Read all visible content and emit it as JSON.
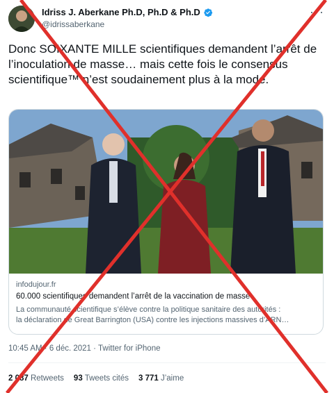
{
  "author": {
    "name": "Idriss J. Aberkane Ph.D, Ph.D & Ph.D",
    "handle": "@idrissaberkane"
  },
  "tweet": {
    "text": "Donc SOIXANTE MILLE scientifiques demandent l’arrêt de l’inoculation de masse… mais cette fois le consensus scientifique™ n’est soudainement plus à la mode."
  },
  "card": {
    "domain": "infodujour.fr",
    "title": "60.000 scientifiques demandent l’arrêt de la vaccination de masse",
    "desc_line1": "La communauté scientifique s’élève contre la politique sanitaire des autorités :",
    "desc_line2": "la déclaration de Great Barrington (USA) contre les injections massives d’ARN…"
  },
  "meta": {
    "time": "10:45 AM",
    "separator1": "·",
    "date": "6 déc. 2021",
    "separator2": "·",
    "source": "Twitter for iPhone"
  },
  "stats": {
    "retweets_count": "2 087",
    "retweets_label": "Retweets",
    "quotes_count": "93",
    "quotes_label": "Tweets cités",
    "likes_count": "3 771",
    "likes_label": "J’aime"
  },
  "colors": {
    "verified": "#1d9bf0",
    "cross": "#e0302b",
    "secondary_text": "#536471"
  },
  "icons": {
    "verified": "verified-badge-icon",
    "more": "more-options-icon"
  }
}
